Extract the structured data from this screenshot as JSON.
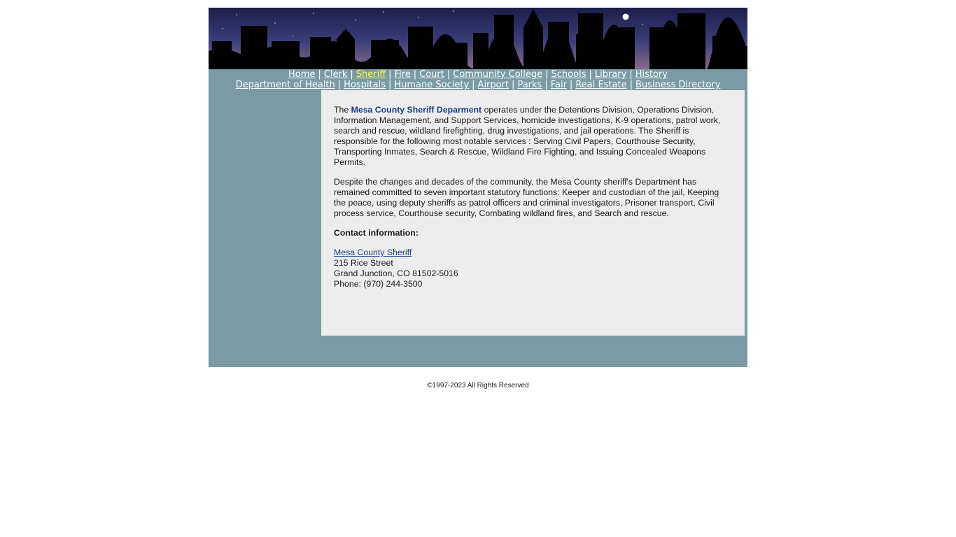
{
  "nav": {
    "row1": [
      "Home",
      "Clerk",
      "Sheriff",
      "Fire",
      "Court",
      "Community College",
      "Schools",
      "Library",
      "History"
    ],
    "row2": [
      "Department of Health",
      "Hospitals",
      "Humane Society",
      "Airport",
      "Parks",
      "Fair",
      "Real Estate",
      "Business Directory"
    ],
    "active": "Sheriff"
  },
  "content": {
    "p1_prefix": "The ",
    "org_name": "Mesa County Sheriff Deparment",
    "p1_rest": " operates under the Detentions Division, Operations Division, Information Management, and Support Services, homicide investigations, K-9 operations, patrol work, search and rescue, wildland firefighting, drug investigations, and jail operations. The Sheriff is responsible for the following most notable services : Serving Civil Papers, Courthouse Security, Transporting Inmates, Search & Rescue, Wildland Fire Fighting, and Issuing Concealed Weapons Permits.",
    "p2": "Despite the changes and decades of the community, the Mesa County sheriff's Department has remained committed to seven important statutory functions: Keeper and custodian of the jail, Keeping the peace, using deputy sheriffs as patrol officers and criminal investigators, Prisoner transport, Civil process service, Courthouse security, Combating wildland fires, and Search and rescue.",
    "contact_heading": "Contact information:",
    "contact_link": "Mesa County Sheriff",
    "address1": "215 Rice Street",
    "address2": "Grand Junction, CO 81502-5016",
    "phone": "Phone: (970) 244-3500"
  },
  "footer": "©1997-2023 All Rights Reserved",
  "colors": {
    "sidebar_bg": "#7a9ba3",
    "content_bg": "#ededed",
    "link": "#1a3e8c",
    "active_nav": "#ffff44"
  }
}
